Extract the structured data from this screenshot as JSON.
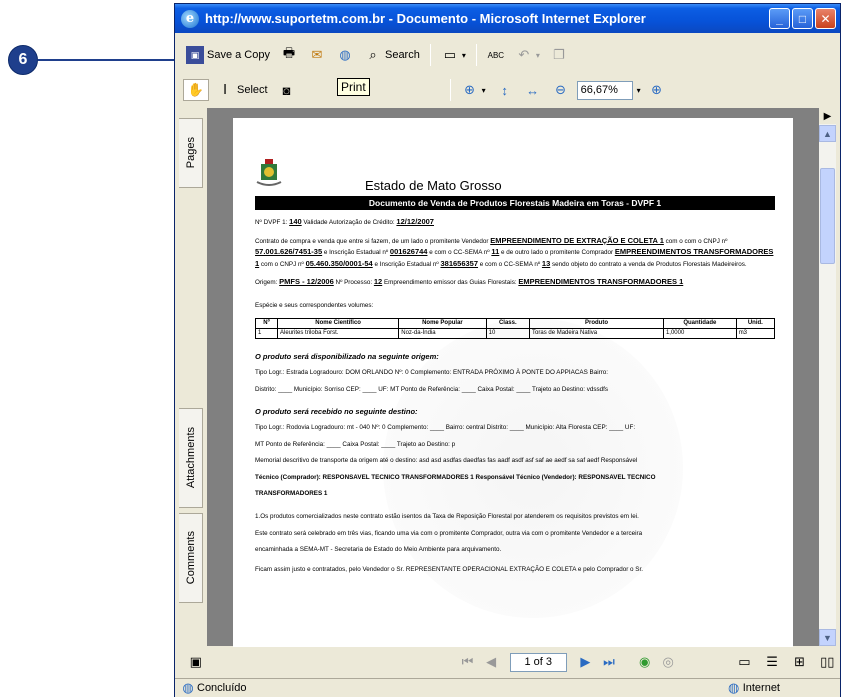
{
  "callout": {
    "number": "6"
  },
  "window": {
    "title": "http://www.suportetm.com.br - Documento - Microsoft Internet Explorer"
  },
  "toolbar1": {
    "save_copy": "Save a Copy",
    "search": "Search"
  },
  "toolbar2": {
    "select": "Select",
    "zoom": "66,67%",
    "tooltip": "Print"
  },
  "nav_tabs": {
    "pages": "Pages",
    "attachments": "Attachments",
    "comments": "Comments"
  },
  "document": {
    "title": "Estado de Mato Grosso",
    "banner": "Documento de Venda de Produtos Florestais Madeira em Toras - DVPF 1",
    "line1_prefix": "Nº DVPF 1:",
    "dvpf": "140",
    "line1_mid": "Validade Autorização de Crédito:",
    "validade": "12/12/2007",
    "contract": "Contrato de compra e venda que entre si fazem, de um lado o promitente Vendedor",
    "vendedor": "EMPREENDIMENTO DE EXTRAÇÃO E COLETA 1",
    "cnpj_label": "com o CNPJ nº",
    "cnpj1": "57.001.626/7451-35",
    "ie_label": "e Inscrição Estadual nº",
    "ie1": "001626744",
    "cc_label": "e com o CC-SEMA nº",
    "cc1": "11",
    "outro": "e de outro lado o promitente Comprador",
    "comprador": "EMPREENDIMENTOS TRANSFORMADORES 1",
    "cnpj2": "05.460.350/0001-54",
    "ie2": "381656357",
    "cc2_label": "e com o CC-SEMA nº",
    "cc2": "13",
    "objeto": "sendo objeto do contrato a venda de Produtos Florestais Madeireiros.",
    "origem_label": "Origem:",
    "origem": "PMFS - 12/2006",
    "processo_label": "Nº Processo:",
    "processo": "12",
    "emissor_label": "Empreendimento emissor das Guias Florestais:",
    "emissor": "EMPREENDIMENTOS TRANSFORMADORES 1",
    "especie": "Espécie e seus correspondentes volumes:",
    "table_headers": [
      "Nº",
      "Nome Científico",
      "Nome Popular",
      "Class.",
      "Produto",
      "Quantidade",
      "Unid."
    ],
    "table_rows": [
      [
        "1",
        "Aleurites triloba Forst.",
        "Noz-da-Índia",
        "10",
        "Toras de Madeira Nativa",
        "1,0000",
        "m3"
      ]
    ],
    "origem_sec": "O produto será disponibilizado na seguinte origem:",
    "origem_addr1": "Tipo Logr.: Estrada Logradouro: DOM ORLANDO Nº: 0 Complemento: ENTRADA PRÓXIMO À PONTE DO APPIACAS Bairro:",
    "origem_addr2": "Distrito: ____ Município: Sorriso CEP: ____ UF: MT Ponto de Referência: ____ Caixa Postal: ____ Trajeto ao Destino: vdssdfs",
    "destino_sec": "O produto será recebido no seguinte destino:",
    "destino_addr1": "Tipo Logr.: Rodovia Logradouro: mt - 040 Nº: 0 Complemento: ____ Bairro: central Distrito: ____ Município: Alta Floresta CEP: ____ UF:",
    "destino_addr2": "MT Ponto de Referência: ____ Caixa Postal: ____ Trajeto ao Destino: p",
    "memorial": "Memorial descritivo de transporte da origem até o destino: asd asd asdfas daedfas fas aadf asdf asf saf ae aedf sa saf aedf Responsável",
    "tecnico": "Técnico (Comprador): RESPONSAVEL TECNICO TRANSFORMADORES 1 Responsável Técnico (Vendedor): RESPONSAVEL TECNICO",
    "tecnico2": "TRANSFORMADORES 1",
    "clause1": "1.Os produtos comercializados neste contrato estão isentos da Taxa de Reposição Florestal por atenderem os requisitos previstos em lei.",
    "clause2": "Este contrato será celebrado em três vias, ficando uma via com o promitente Comprador, outra via com o promitente Vendedor e a terceira",
    "clause3": "encaminhada a SEMA-MT - Secretaria de Estado do Meio Ambiente para arquivamento.",
    "closing": "Ficam assim justo e contratados, pelo Vendedor o Sr. REPRESENTANTE OPERACIONAL EXTRAÇÃO E COLETA e pelo Comprador o Sr."
  },
  "navbar": {
    "page": "1 of 3"
  },
  "status": {
    "left": "Concluído",
    "right": "Internet"
  }
}
